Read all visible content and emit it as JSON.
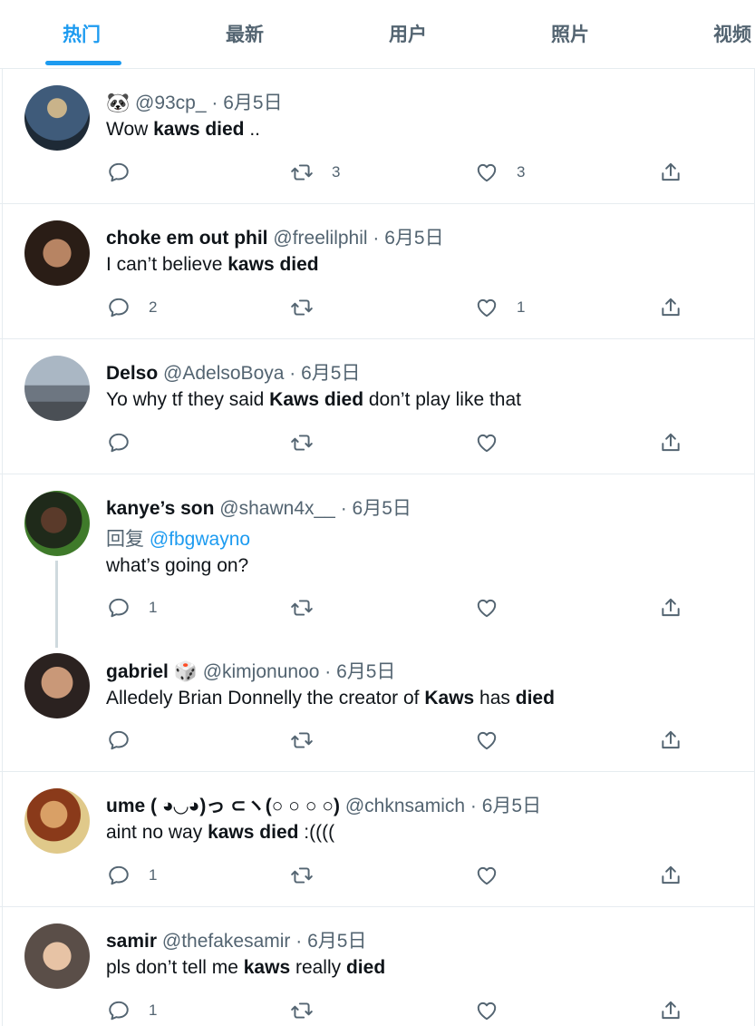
{
  "tabs": [
    "热门",
    "最新",
    "用户",
    "照片",
    "视频"
  ],
  "tweets": [
    {
      "name": "🐼",
      "handle": "@93cp_",
      "time": "· 6月5日",
      "text_pre": "Wow ",
      "bold1": "kaws died",
      "text_mid": " ..",
      "bold2": "",
      "text_post": "",
      "reply_count": "",
      "retweet_count": "3",
      "like_count": "3"
    },
    {
      "name": "choke em out phil",
      "handle": "@freelilphil",
      "time": "· 6月5日",
      "text_pre": "I can’t believe ",
      "bold1": "kaws died",
      "text_mid": "",
      "bold2": "",
      "text_post": "",
      "reply_count": "2",
      "retweet_count": "",
      "like_count": "1"
    },
    {
      "name": "Delso",
      "handle": "@AdelsoBoya",
      "time": "· 6月5日",
      "text_pre": "Yo why tf they said ",
      "bold1": "Kaws died",
      "text_mid": " don’t play like that",
      "bold2": "",
      "text_post": "",
      "reply_count": "",
      "retweet_count": "",
      "like_count": ""
    },
    {
      "name": "kanye’s son",
      "handle": "@shawn4x__",
      "time": "· 6月5日",
      "reply_to_prefix": "回复 ",
      "reply_to_handle": "@fbgwayno",
      "text": "what’s going on?",
      "reply_count": "1",
      "retweet_count": "",
      "like_count": ""
    },
    {
      "name": "gabriel 🎲",
      "handle": "@kimjonunoo",
      "time": "· 6月5日",
      "text_pre": "Alledely Brian Donnelly the creator of ",
      "bold1": "Kaws",
      "text_mid": " has ",
      "bold2": "died",
      "text_post": "",
      "reply_count": "",
      "retweet_count": "",
      "like_count": ""
    },
    {
      "name": "ume ( ◕◡◕)っ ⊂ヽ(○ ○ ○ ○)",
      "handle": "@chknsamich",
      "time": "· 6月5日",
      "text_pre": "aint no way ",
      "bold1": "kaws died",
      "text_mid": " :((((",
      "bold2": "",
      "text_post": "",
      "reply_count": "1",
      "retweet_count": "",
      "like_count": ""
    },
    {
      "name": "samir",
      "handle": "@thefakesamir",
      "time": "· 6月5日",
      "text_pre": "pls don’t tell me ",
      "bold1": "kaws",
      "text_mid": " really ",
      "bold2": "died",
      "text_post": "",
      "reply_count": "1",
      "retweet_count": "",
      "like_count": ""
    }
  ],
  "colors": {
    "accent": "#1d9bf0",
    "muted": "#536471",
    "divider": "#e6ecf0"
  },
  "icons": [
    "reply-icon",
    "retweet-icon",
    "like-icon",
    "share-icon"
  ]
}
